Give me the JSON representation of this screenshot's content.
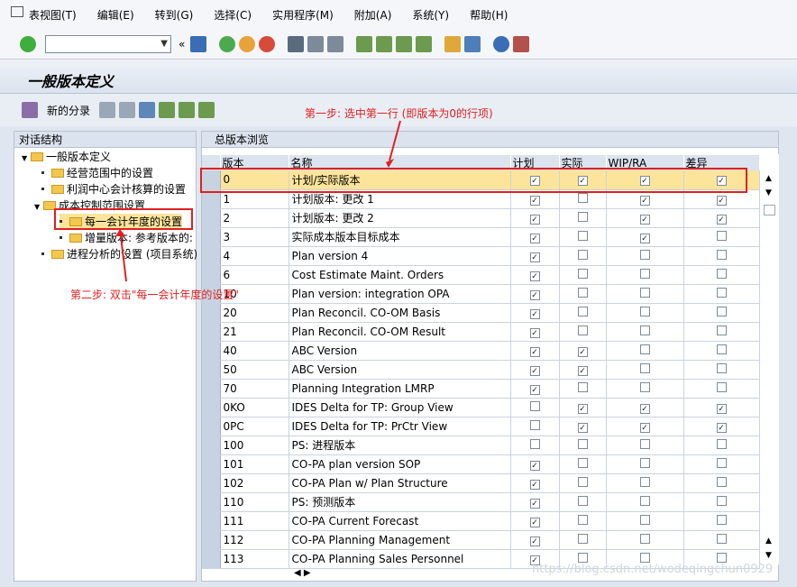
{
  "menu": [
    "表视图(T)",
    "编辑(E)",
    "转到(G)",
    "选择(C)",
    "实用程序(M)",
    "附加(A)",
    "系统(Y)",
    "帮助(H)"
  ],
  "page_title": "一般版本定义",
  "app_toolbar": {
    "new_entries": "新的分录"
  },
  "tree": {
    "header": "对话结构",
    "root": "一般版本定义",
    "items": [
      "经营范围中的设置",
      "利润中心会计核算的设置",
      "成本控制范围设置",
      "每一会计年度的设置",
      "增量版本: 参考版本的:",
      "进程分析的设置 (项目系统)"
    ]
  },
  "grid": {
    "title": "总版本浏览",
    "columns": [
      "版本",
      "名称",
      "计划",
      "实际",
      "WIP/RA",
      "差异"
    ],
    "rows": [
      [
        "0",
        "计划/实际版本",
        1,
        1,
        1,
        1
      ],
      [
        "1",
        "计划版本: 更改 1",
        1,
        0,
        1,
        1
      ],
      [
        "2",
        "计划版本: 更改 2",
        1,
        0,
        1,
        1
      ],
      [
        "3",
        "实际成本版本目标成本",
        1,
        0,
        1,
        0
      ],
      [
        "4",
        "Plan version 4",
        1,
        0,
        0,
        0
      ],
      [
        "6",
        "Cost Estimate Maint. Orders",
        1,
        0,
        0,
        0
      ],
      [
        "10",
        "Plan version: integration OPA",
        1,
        0,
        0,
        0
      ],
      [
        "20",
        "Plan Reconcil. CO-OM Basis",
        1,
        0,
        0,
        0
      ],
      [
        "21",
        "Plan Reconcil. CO-OM Result",
        1,
        0,
        0,
        0
      ],
      [
        "40",
        "ABC Version",
        1,
        1,
        0,
        0
      ],
      [
        "50",
        "ABC Version",
        1,
        1,
        0,
        0
      ],
      [
        "70",
        "Planning Integration LMRP",
        1,
        0,
        0,
        0
      ],
      [
        "0KO",
        "IDES Delta for TP: Group View",
        0,
        1,
        1,
        1
      ],
      [
        "0PC",
        "IDES Delta for TP: PrCtr View",
        0,
        1,
        1,
        1
      ],
      [
        "100",
        "PS: 进程版本",
        0,
        0,
        0,
        0
      ],
      [
        "101",
        "CO-PA plan version SOP",
        1,
        0,
        0,
        0
      ],
      [
        "102",
        "CO-PA Plan w/ Plan Structure",
        1,
        0,
        0,
        0
      ],
      [
        "110",
        "PS: 预测版本",
        1,
        0,
        0,
        0
      ],
      [
        "111",
        "CO-PA Current Forecast",
        1,
        0,
        0,
        0
      ],
      [
        "112",
        "CO-PA Planning Management",
        1,
        0,
        0,
        0
      ],
      [
        "113",
        "CO-PA Planning Sales Personnel",
        1,
        0,
        0,
        0
      ]
    ]
  },
  "annotations": {
    "step1": "第一步: 选中第一行 (即版本为0的行项)",
    "step2": "第二步: 双击\"每一会计年度的设置\""
  },
  "watermark": "https://blog.csdn.net/wodeqingchun0929"
}
